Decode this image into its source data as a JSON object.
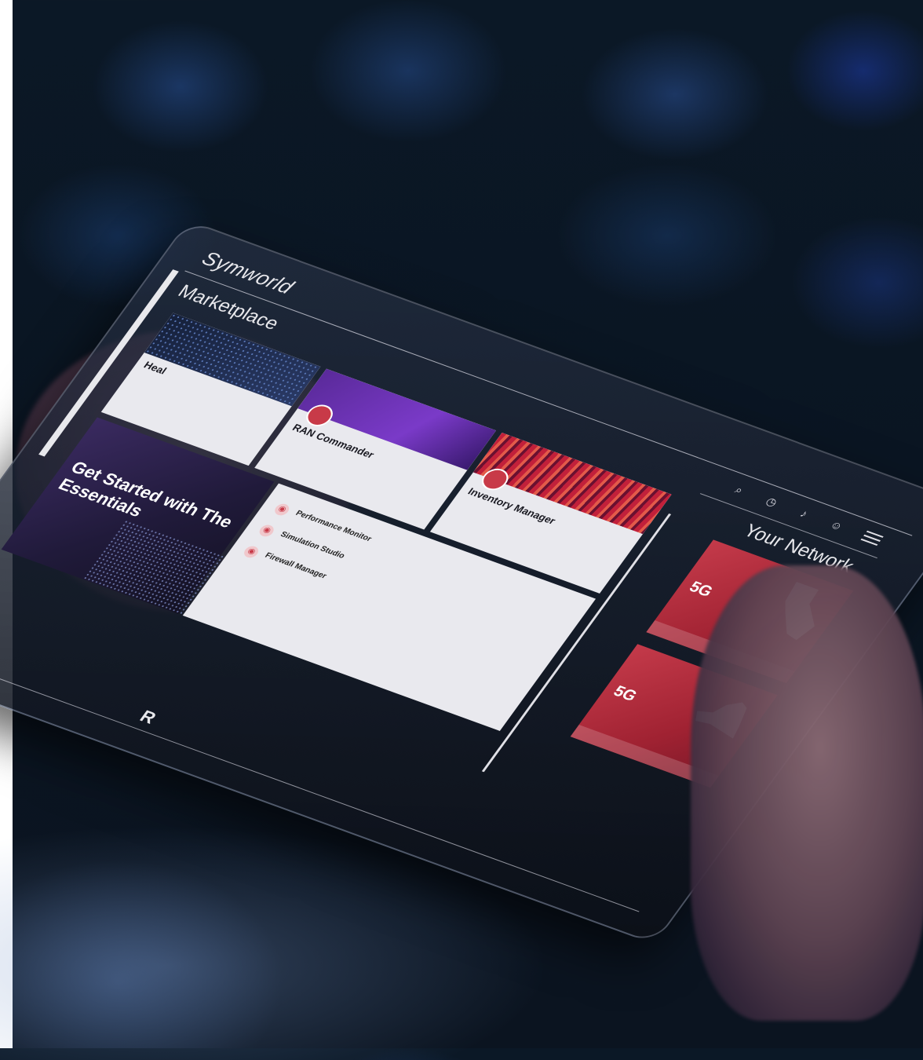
{
  "app": {
    "brand": "Symworld",
    "logo_letter": "R"
  },
  "marketplace": {
    "title": "Marketplace",
    "cards": [
      {
        "name": "Heal"
      },
      {
        "name": "RAN Commander"
      },
      {
        "name": "Inventory Manager"
      }
    ],
    "featured": {
      "title": "Get Started with The Essentials"
    },
    "list": [
      {
        "name": "Performance Monitor"
      },
      {
        "name": "Simulation Studio"
      },
      {
        "name": "Firewall Manager"
      }
    ]
  },
  "network": {
    "title": "Your Network",
    "regions": [
      {
        "label": "5G"
      },
      {
        "label": "5G"
      }
    ]
  },
  "icons": [
    "search-icon",
    "clock-icon",
    "bell-icon",
    "user-icon",
    "menu-icon"
  ],
  "colors": {
    "accent": "#c83a48",
    "purple": "#6a30b8",
    "panel": "#e9e9ee"
  }
}
